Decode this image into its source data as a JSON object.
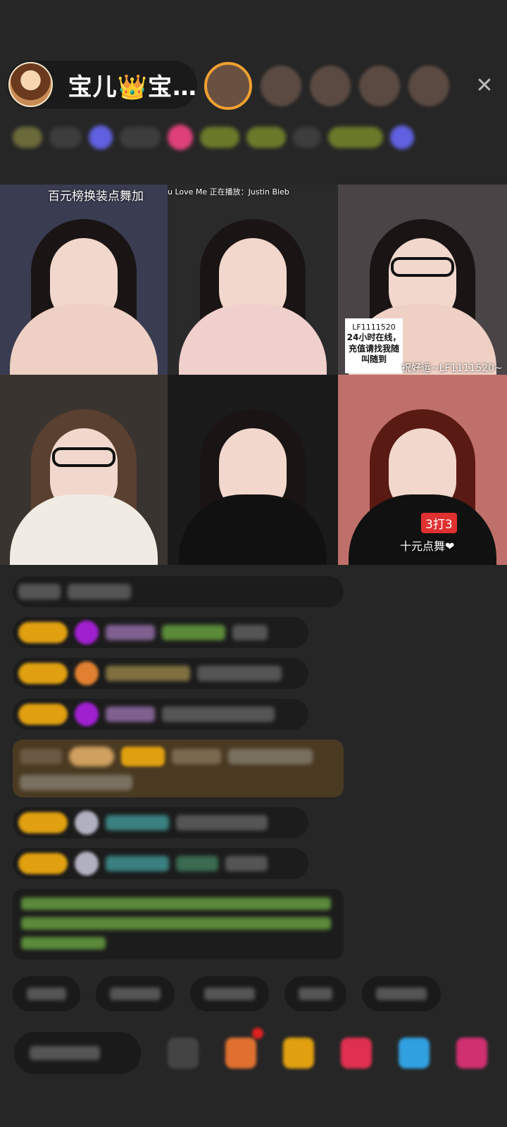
{
  "host": {
    "name": "宝儿👑宝…"
  },
  "tiles": [
    {
      "label": "百元榜换装点舞加",
      "bg": "#3a3c52"
    },
    {
      "label": "u Love Me  正在播放：Justin Bieb",
      "bg": "#2a2a2a"
    },
    {
      "label": "祝好运~LF1111520~",
      "bg": "#4a4446",
      "sticker_id": "LF1111520",
      "sticker_text": "24小时在线，充值请找我随叫随到"
    },
    {
      "label": "",
      "bg": "#3a3430"
    },
    {
      "label": "",
      "bg": "#1a1a1a"
    },
    {
      "label": "十元点舞❤",
      "bg": "#c0706a",
      "badge": "3打3"
    }
  ],
  "colors": {
    "background": "#262626",
    "accent": "#f0a030"
  }
}
